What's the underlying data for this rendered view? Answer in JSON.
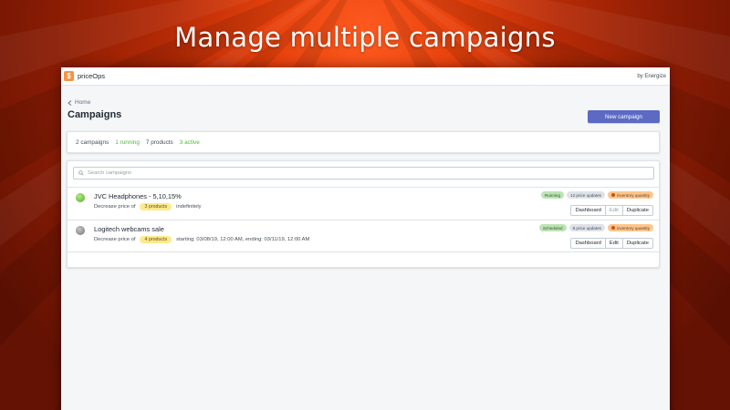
{
  "headline": "Manage multiple campaigns",
  "app": {
    "name": "priceOps",
    "by_line": "by Energize",
    "logo_glyph": "$",
    "accent": "#5c6ac4"
  },
  "breadcrumb": {
    "label": "Home"
  },
  "page_title": "Campaigns",
  "new_campaign_label": "New campaign",
  "summary": {
    "campaigns": "2 campaigns",
    "running": "1 running",
    "products": "7 products",
    "active": "3 active"
  },
  "search": {
    "placeholder": "Search campaigns"
  },
  "campaigns": [
    {
      "title": "JVC Headphones - 5,10,15%",
      "status_dot": "running",
      "sub_prefix": "Decrease price of",
      "products_pill": "3 products",
      "schedule": "indefinitely",
      "badges": {
        "status": "Running",
        "updates": "12 price updates",
        "trigger": "inventory quantity"
      },
      "actions": {
        "dashboard": "Dashboard",
        "edit": "Edit",
        "duplicate": "Duplicate"
      }
    },
    {
      "title": "Logitech webcams sale",
      "status_dot": "scheduled",
      "sub_prefix": "Decrease price of",
      "products_pill": "4 products",
      "schedule": "starting: 03/08/19, 12:00 AM, ending: 03/11/19, 12:00 AM",
      "badges": {
        "status": "Scheduled",
        "updates": "8 price updates",
        "trigger": "inventory quantity"
      },
      "actions": {
        "dashboard": "Dashboard",
        "edit": "Edit",
        "duplicate": "Duplicate"
      }
    }
  ]
}
